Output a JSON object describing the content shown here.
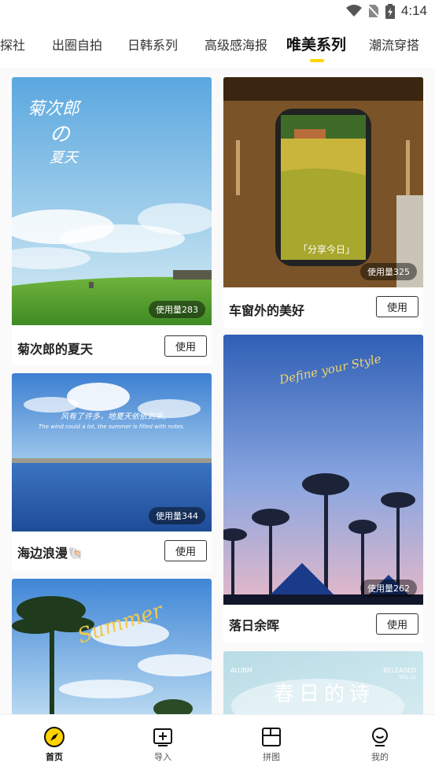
{
  "status_bar": {
    "time": "4:14"
  },
  "tabs": [
    {
      "label": "探社"
    },
    {
      "label": "出圈自拍"
    },
    {
      "label": "日韩系列"
    },
    {
      "label": "高级感海报"
    },
    {
      "label": "唯美系列"
    },
    {
      "label": "潮流穿搭"
    }
  ],
  "active_tab_index": 4,
  "colors": {
    "accent": "#ffd400"
  },
  "cards": [
    {
      "title": "菊次郎的夏天",
      "usage": "使用量283",
      "button": "使用",
      "image_text": [
        "菊次郎",
        "の",
        "夏天"
      ]
    },
    {
      "title": "车窗外的美好",
      "usage": "使用量325",
      "button": "使用",
      "image_text": [
        "「分享今日」"
      ]
    },
    {
      "title": "海边浪漫🐚",
      "usage": "使用量344",
      "button": "使用",
      "image_text": [
        "风有了许多，地夏天依依到来。",
        "The wind could a lot, the summer is filled with notes."
      ]
    },
    {
      "title": "落日余晖",
      "usage": "使用量262",
      "button": "使用",
      "image_text": [
        "Define your Style"
      ]
    },
    {
      "title": "",
      "usage": "",
      "button": "",
      "image_text": [
        "Summer"
      ]
    },
    {
      "title": "",
      "usage": "",
      "button": "",
      "image_text": [
        "春日的诗",
        "ALUBM",
        "RELEASED",
        "VOL.12"
      ]
    }
  ],
  "bottom_nav": [
    {
      "label": "首页",
      "icon": "compass-icon"
    },
    {
      "label": "导入",
      "icon": "import-icon"
    },
    {
      "label": "拼图",
      "icon": "collage-icon"
    },
    {
      "label": "我的",
      "icon": "profile-icon"
    }
  ]
}
